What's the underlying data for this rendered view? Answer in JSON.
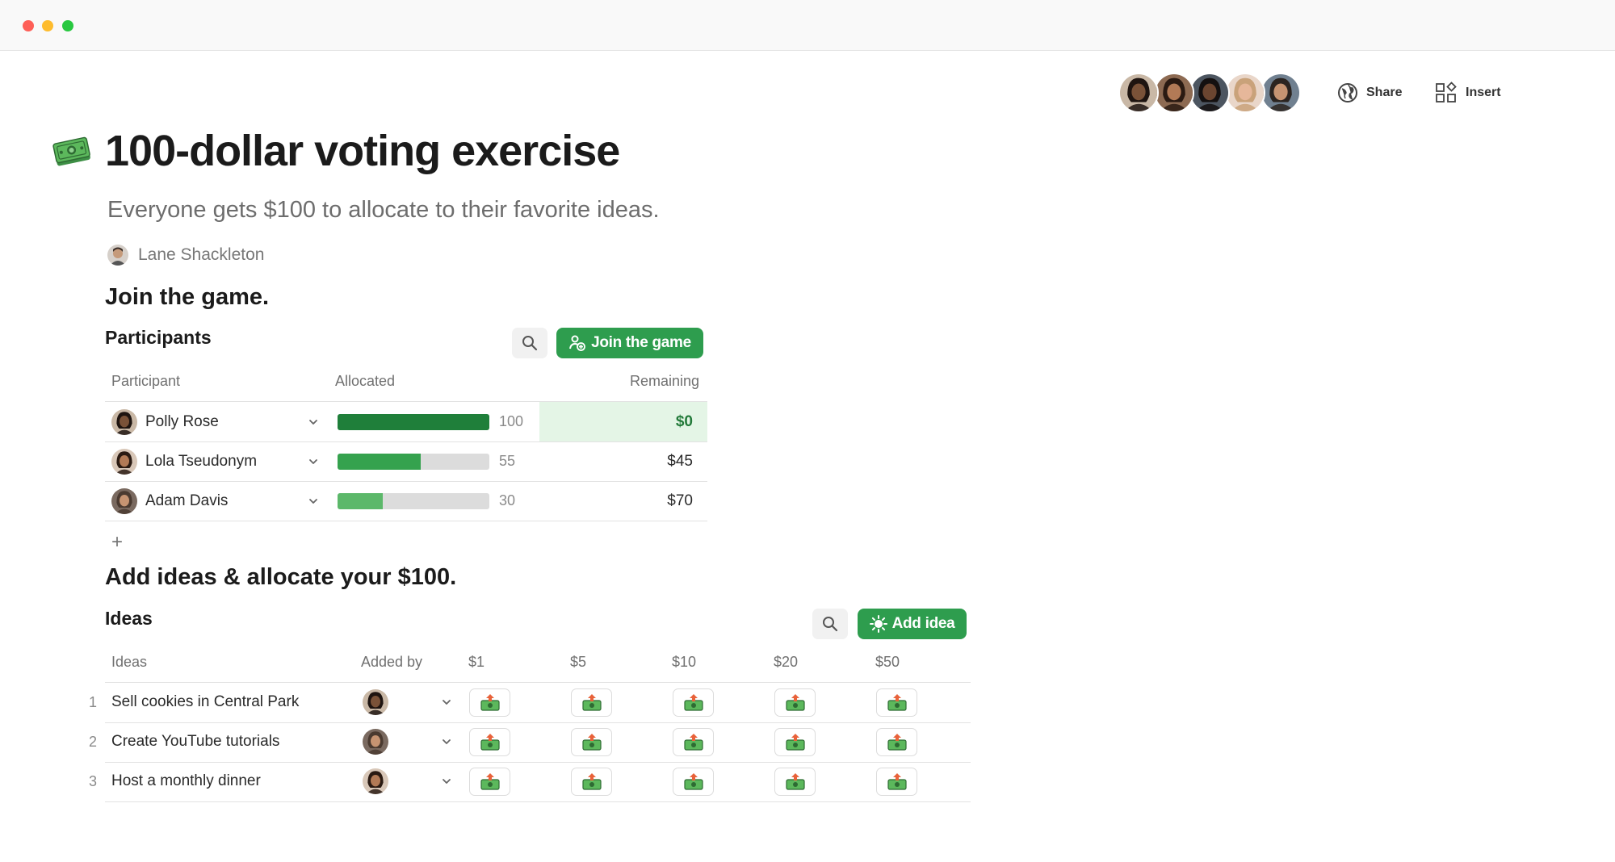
{
  "header": {
    "share_label": "Share",
    "insert_label": "Insert",
    "collaborators": [
      {
        "skin": "#7a5238",
        "hair": "#1e1410",
        "bg": "#c9b8a6"
      },
      {
        "skin": "#b27a56",
        "hair": "#2a1a12",
        "bg": "#8d6a52"
      },
      {
        "skin": "#6b4530",
        "hair": "#141010",
        "bg": "#4c5560"
      },
      {
        "skin": "#e6b79a",
        "hair": "#c9a27a",
        "bg": "#e9d6c9"
      },
      {
        "skin": "#c69472",
        "hair": "#2b2420",
        "bg": "#708090"
      }
    ]
  },
  "doc": {
    "icon": "money-icon",
    "title": "100-dollar voting exercise",
    "subtitle": "Everyone gets $100 to allocate to their favorite ideas.",
    "author": "Lane Shackleton"
  },
  "join_section": {
    "heading": "Join the game.",
    "table_title": "Participants",
    "join_button_label": "Join the game",
    "columns": [
      "Participant",
      "Allocated",
      "Remaining"
    ],
    "rows": [
      {
        "name": "Polly Rose",
        "allocated": 100,
        "allocated_label": "100",
        "remaining": "$0",
        "bar_color": "#1f7f3a",
        "avatar": {
          "skin": "#7a5238",
          "hair": "#1e1410",
          "bg": "#c9b8a6"
        }
      },
      {
        "name": "Lola Tseudonym",
        "allocated": 55,
        "allocated_label": "55",
        "remaining": "$45",
        "bar_color": "#35a24e",
        "avatar": {
          "skin": "#b27a56",
          "hair": "#2a1a12",
          "bg": "#d8c7b8"
        }
      },
      {
        "name": "Adam Davis",
        "allocated": 30,
        "allocated_label": "30",
        "remaining": "$70",
        "bar_color": "#5cb86a",
        "avatar": {
          "skin": "#c69472",
          "hair": "#4a3a30",
          "bg": "#7a6a60"
        }
      }
    ],
    "add_row_label": "+"
  },
  "ideas_section": {
    "heading": "Add ideas & allocate your $100.",
    "table_title": "Ideas",
    "add_button_label": "Add idea",
    "columns": [
      "Ideas",
      "Added by",
      "$1",
      "$5",
      "$10",
      "$20",
      "$50"
    ],
    "rows": [
      {
        "index": "1",
        "idea": "Sell cookies in Central Park",
        "avatar": {
          "skin": "#7a5238",
          "hair": "#1e1410",
          "bg": "#c9b8a6"
        }
      },
      {
        "index": "2",
        "idea": "Create YouTube tutorials",
        "avatar": {
          "skin": "#c69472",
          "hair": "#4a3a30",
          "bg": "#7a6a60"
        }
      },
      {
        "index": "3",
        "idea": "Host a monthly dinner",
        "avatar": {
          "skin": "#b27a56",
          "hair": "#2a1a12",
          "bg": "#d8c7b8"
        }
      }
    ]
  },
  "colors": {
    "accent_green": "#2e9d4e",
    "zero_remaining_bg": "#e4f5e6"
  }
}
